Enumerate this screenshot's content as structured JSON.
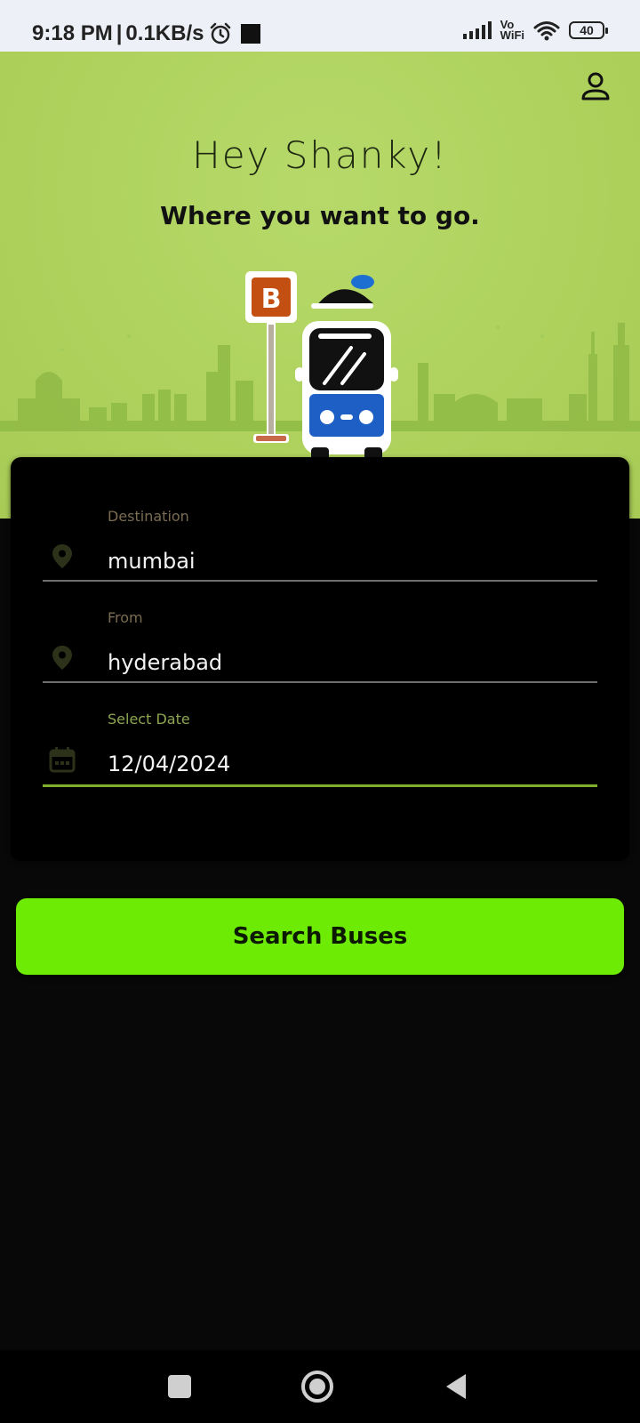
{
  "status_bar": {
    "time": "9:18 PM",
    "separator": "|",
    "speed": "0.1KB/s",
    "network_label_top": "Vo",
    "network_label_bottom": "WiFi",
    "battery": "40"
  },
  "hero": {
    "greeting": "Hey Shanky!",
    "subtitle": "Where you want to go.",
    "bus_stop_sign": "B"
  },
  "form": {
    "destination": {
      "label": "Destination",
      "value": "mumbai",
      "icon": "location-pin-icon"
    },
    "from": {
      "label": "From",
      "value": "hyderabad",
      "icon": "location-pin-icon"
    },
    "date": {
      "label": "Select Date",
      "value": "12/04/2024",
      "icon": "calendar-icon"
    }
  },
  "actions": {
    "search_label": "Search Buses"
  },
  "colors": {
    "hero_bg": "#aed15c",
    "accent_button": "#6deb05",
    "active_underline": "#7fae2e",
    "page_bg": "#080808"
  }
}
